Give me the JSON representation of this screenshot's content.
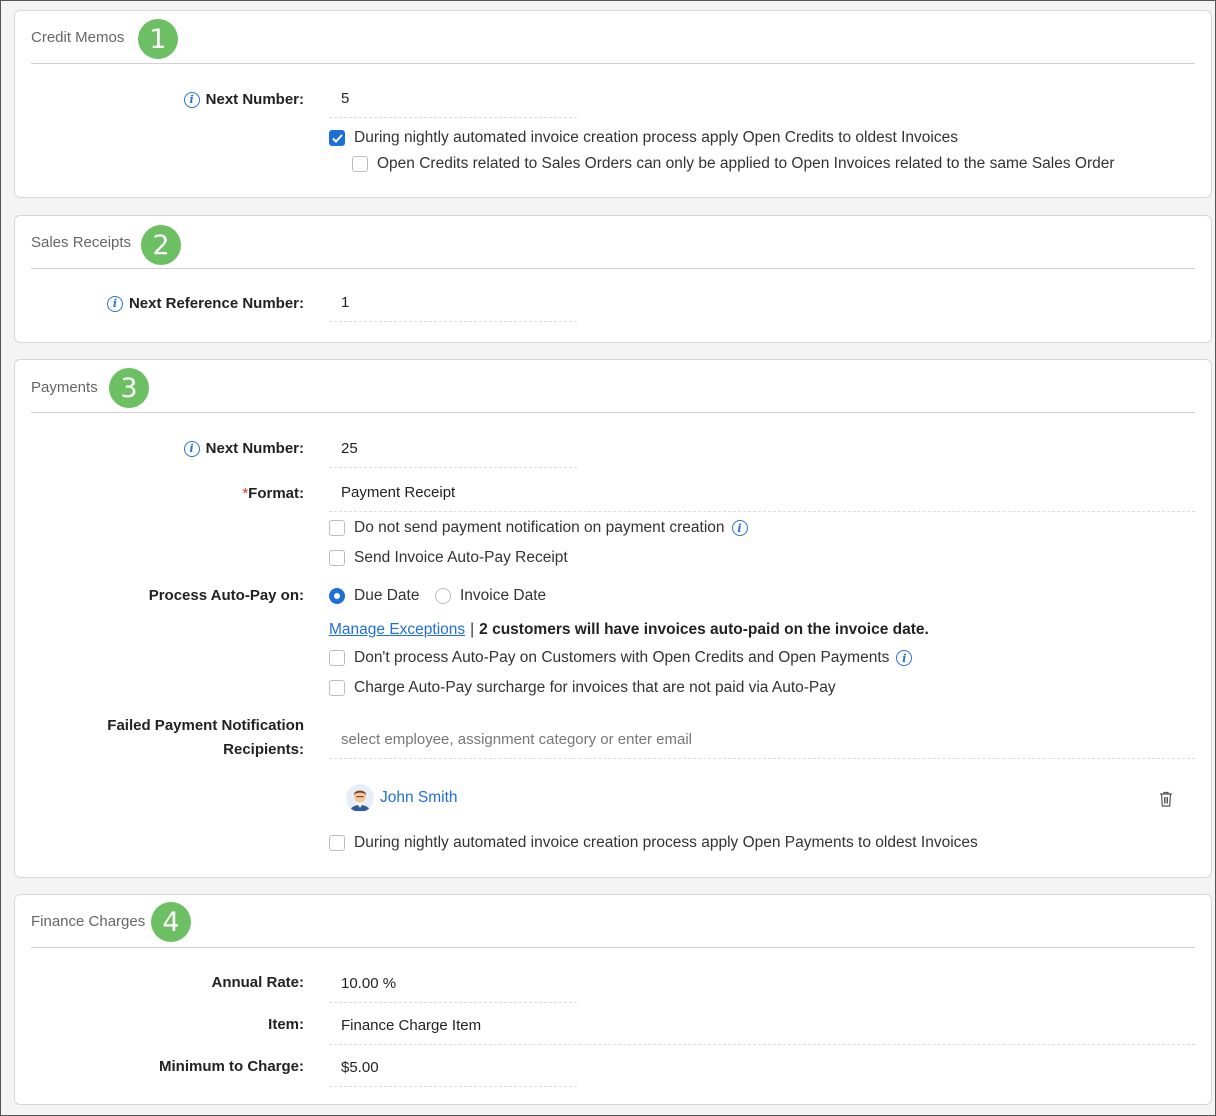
{
  "credit_memos": {
    "title": "Credit Memos",
    "badge": "1",
    "next_number_label": "Next Number:",
    "next_number_value": "5",
    "apply_open_credits_label": "During nightly automated invoice creation process apply Open Credits to oldest Invoices",
    "apply_open_credits_checked": true,
    "sales_order_restriction_label": "Open Credits related to Sales Orders can only be applied to Open Invoices related to the same Sales Order",
    "sales_order_restriction_checked": false
  },
  "sales_receipts": {
    "title": "Sales Receipts",
    "badge": "2",
    "next_ref_label": "Next Reference Number:",
    "next_ref_value": "1"
  },
  "payments": {
    "title": "Payments",
    "badge": "3",
    "next_number_label": "Next Number:",
    "next_number_value": "25",
    "format_required": "*",
    "format_label": "Format:",
    "format_value": "Payment Receipt",
    "no_notify_label": "Do not send payment notification on payment creation",
    "send_receipt_label": "Send Invoice Auto-Pay Receipt",
    "process_autopay_label": "Process Auto-Pay on:",
    "radio_due_date": "Due Date",
    "radio_invoice_date": "Invoice Date",
    "selected_radio": "Due Date",
    "manage_exceptions": "Manage Exceptions",
    "separator": "|",
    "exceptions_note": "2 customers will have invoices auto-paid on the invoice date.",
    "dont_process_label": "Don't process Auto-Pay on Customers with Open Credits and Open Payments",
    "surcharge_label": "Charge Auto-Pay surcharge for invoices that are not paid via Auto-Pay",
    "failed_recipients_label": "Failed Payment Notification Recipients:",
    "recipients_placeholder": "select employee, assignment category or enter email",
    "recipients": [
      {
        "name": "John Smith"
      }
    ],
    "apply_open_payments_label": "During nightly automated invoice creation process apply Open Payments to oldest Invoices"
  },
  "finance_charges": {
    "title": "Finance Charges",
    "badge": "4",
    "annual_rate_label": "Annual Rate:",
    "annual_rate_value": "10.00 %",
    "item_label": "Item:",
    "item_value": "Finance Charge Item",
    "minimum_label": "Minimum to Charge:",
    "minimum_value": "$5.00"
  },
  "colors": {
    "badge": "#6cbf62",
    "accent": "#1f6fd8",
    "required": "#dd3333"
  },
  "icons": [
    "info-icon",
    "check-icon",
    "trash-icon",
    "avatar"
  ]
}
